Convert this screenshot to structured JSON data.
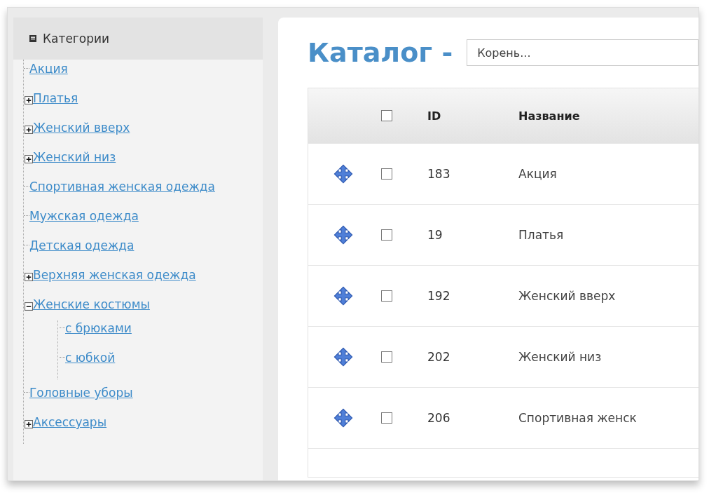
{
  "sidebar": {
    "title": "Категории",
    "tree": [
      {
        "label": "Акция"
      },
      {
        "label": "Платья",
        "expanded": false
      },
      {
        "label": "Женский вверх",
        "expanded": false
      },
      {
        "label": "Женский низ",
        "expanded": false
      },
      {
        "label": "Спортивная женская одежда"
      },
      {
        "label": "Мужская одежда"
      },
      {
        "label": "Детская одежда"
      },
      {
        "label": "Верхняя женская одежда",
        "expanded": false
      },
      {
        "label": "Женские костюмы",
        "expanded": true,
        "children": [
          {
            "label": "с брюками"
          },
          {
            "label": "с юбкой"
          }
        ]
      },
      {
        "label": "Головные уборы"
      },
      {
        "label": "Аксессуары",
        "expanded": false
      }
    ]
  },
  "catalog": {
    "title": "Каталог -",
    "search": {
      "placeholder": "Корень..."
    },
    "table": {
      "columns": [
        "ID",
        "Название"
      ],
      "header_checked": false,
      "rows": [
        {
          "checked": false,
          "id": "183",
          "name": "Акция"
        },
        {
          "checked": false,
          "id": "19",
          "name": "Платья"
        },
        {
          "checked": false,
          "id": "192",
          "name": "Женский вверх"
        },
        {
          "checked": false,
          "id": "202",
          "name": "Женский низ"
        },
        {
          "checked": false,
          "id": "206",
          "name": "Спортивная женск"
        }
      ]
    }
  }
}
